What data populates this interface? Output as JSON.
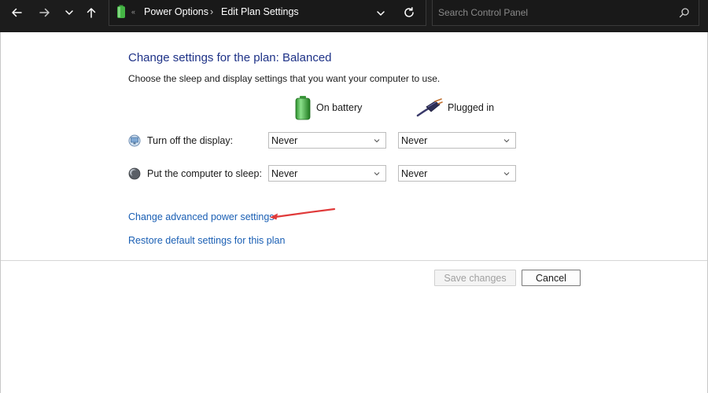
{
  "nav": {
    "back_icon": "arrow-left-icon",
    "forward_icon": "arrow-right-icon",
    "recent_icon": "chevron-down-icon",
    "up_icon": "arrow-up-icon",
    "breadcrumb_separator_start": "«",
    "breadcrumb": [
      "Power Options",
      "Edit Plan Settings"
    ],
    "breadcrumb_separator": "›",
    "refresh_icon": "refresh-icon",
    "search_placeholder": "Search Control Panel"
  },
  "main": {
    "title": "Change settings for the plan: Balanced",
    "subtitle": "Choose the sleep and display settings that you want your computer to use.",
    "columns": {
      "battery": "On battery",
      "plugged": "Plugged in"
    },
    "rows": [
      {
        "label": "Turn off the display:",
        "battery": "Never",
        "plugged": "Never"
      },
      {
        "label": "Put the computer to sleep:",
        "battery": "Never",
        "plugged": "Never"
      }
    ],
    "links": {
      "advanced": "Change advanced power settings",
      "restore": "Restore default settings for this plan"
    },
    "buttons": {
      "save": "Save changes",
      "cancel": "Cancel"
    }
  },
  "colors": {
    "title": "#1e3287",
    "link": "#1a5fb4",
    "annotation_arrow": "#e03a3a",
    "topbar": "#1c1c1c"
  }
}
